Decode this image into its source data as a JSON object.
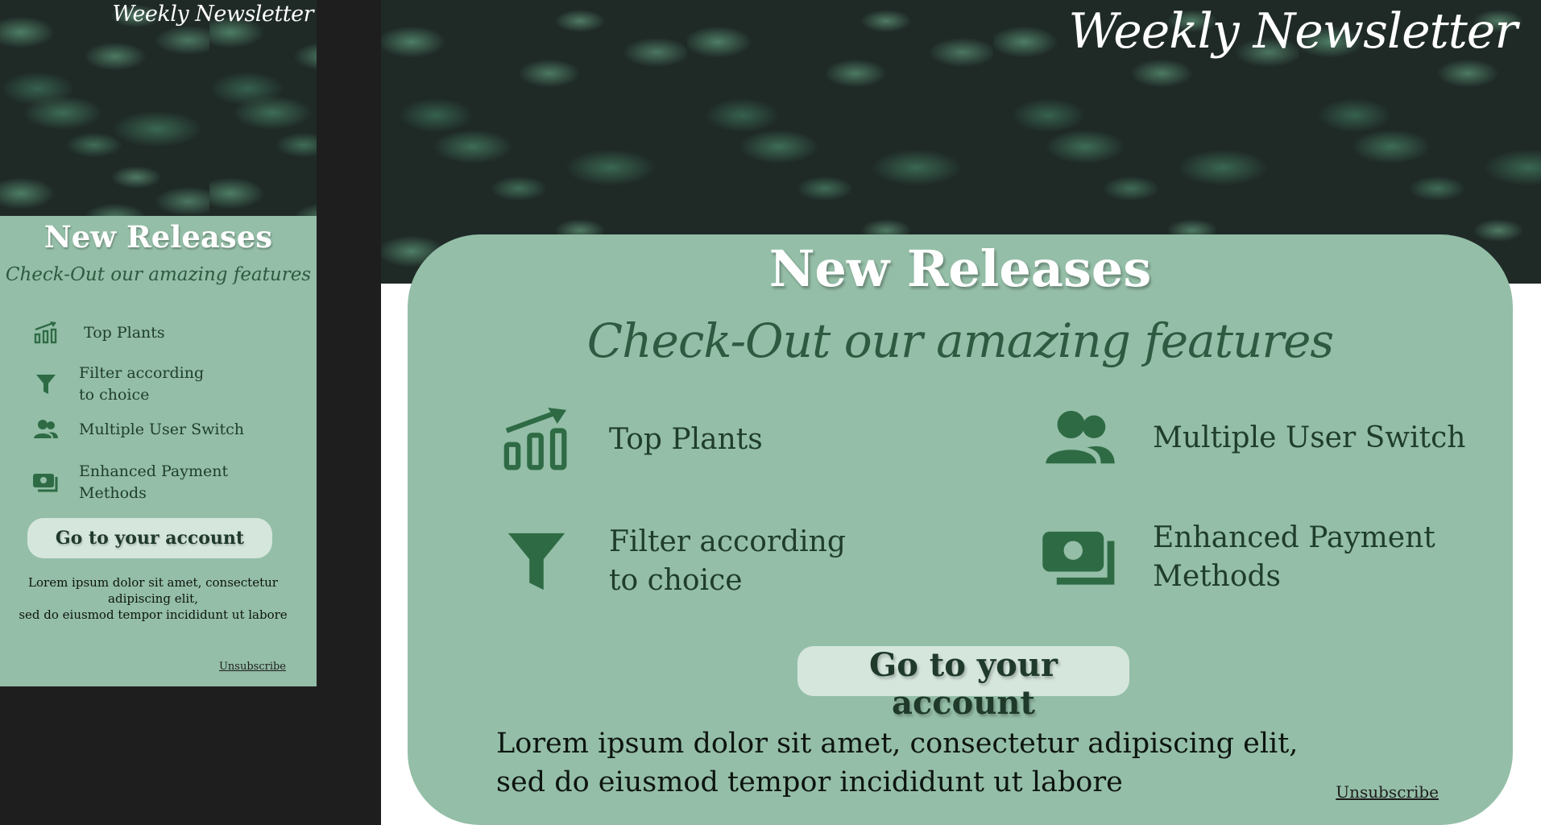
{
  "brand": "Weekly Newsletter",
  "title": "New Releases",
  "subtitle": "Check-Out our amazing features",
  "features": [
    {
      "label": "Top Plants",
      "icon": "chart-icon"
    },
    {
      "label": "Filter according\n to choice",
      "icon": "filter-icon"
    },
    {
      "label": "Multiple User Switch",
      "icon": "users-icon"
    },
    {
      "label": "Enhanced Payment\nMethods",
      "icon": "money-icon"
    }
  ],
  "cta_label": "Go to your account",
  "body_mobile": "Lorem ipsum dolor sit amet, consectetur\nadipiscing elit,\nsed do eiusmod tempor incididunt ut labore",
  "body_desktop": "Lorem ipsum dolor sit amet, consectetur adipiscing elit,\nsed do eiusmod tempor incididunt ut labore",
  "unsubscribe": "Unsubscribe",
  "colors": {
    "card": "#94bea7",
    "icon": "#2e6b45",
    "button": "#d5e6dd",
    "background": "#1e1e1e"
  }
}
